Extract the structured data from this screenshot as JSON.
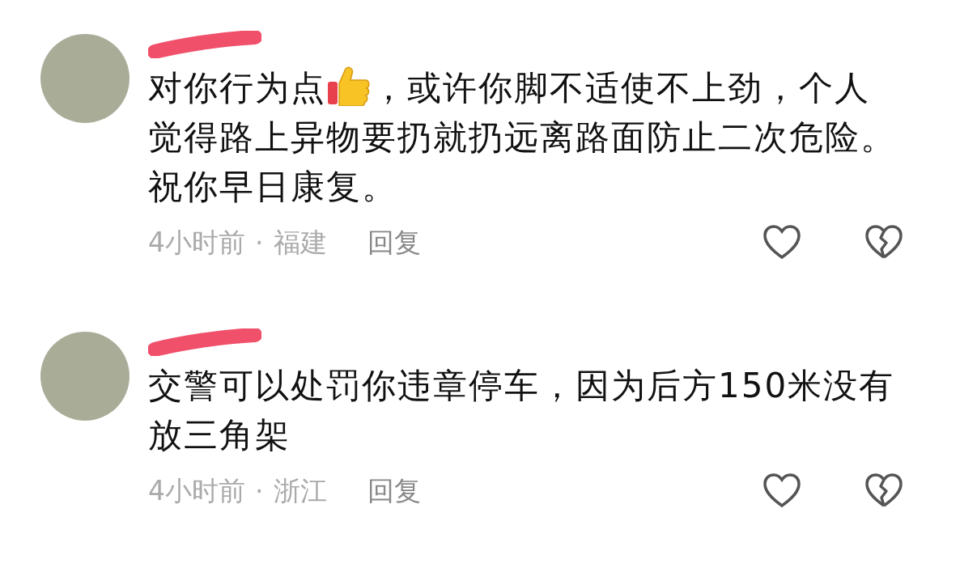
{
  "comments": [
    {
      "segments": [
        {
          "kind": "text",
          "text": "对你行为点"
        },
        {
          "kind": "emoji"
        },
        {
          "kind": "text",
          "text": "，或许你脚不适使不上劲，个人"
        },
        {
          "kind": "block",
          "text": "觉得路上异物要扔就扔远离路面防止二次危险。祝你早日康复。"
        }
      ],
      "time": "4小时前",
      "location": "福建",
      "reply": "回复"
    },
    {
      "segments": [
        {
          "kind": "block",
          "text": "交警可以处罚你违章停车，因为后方150米没有放三角架"
        }
      ],
      "time": "4小时前",
      "location": "浙江",
      "reply": "回复"
    }
  ],
  "separator": "·"
}
